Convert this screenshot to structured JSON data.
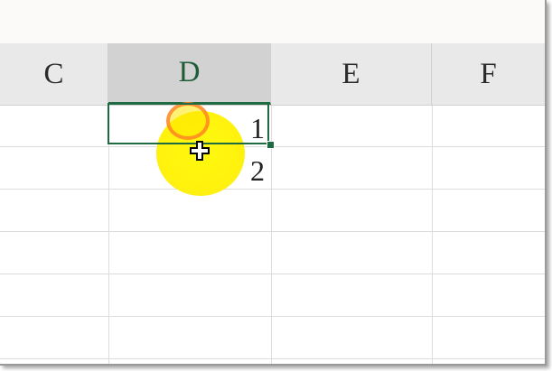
{
  "columns": [
    {
      "label": "C"
    },
    {
      "label": "D"
    },
    {
      "label": "E"
    },
    {
      "label": "F"
    }
  ],
  "selected_column": "D",
  "cells": {
    "D1": "1",
    "D2": "2"
  },
  "colors": {
    "selection_border": "#1e6b41",
    "header_bg": "#e9e9e9",
    "selected_header_bg": "#d2d2d2",
    "click_highlight": "#fff200"
  },
  "cursor": "cross-cursor-icon"
}
